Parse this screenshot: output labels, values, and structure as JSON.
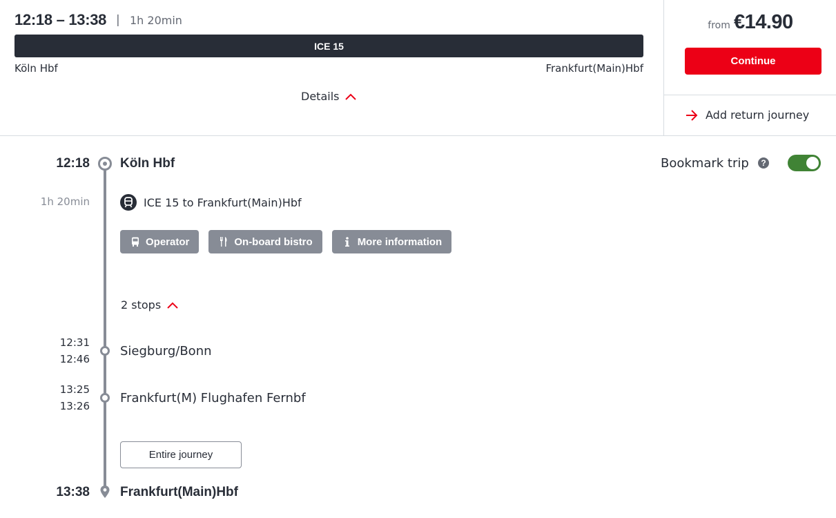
{
  "summary": {
    "time_range": "12:18 – 13:38",
    "separator": "|",
    "duration": "1h 20min",
    "train": "ICE 15",
    "from_station": "Köln Hbf",
    "to_station": "Frankfurt(Main)Hbf",
    "details_label": "Details"
  },
  "side": {
    "from_label": "from",
    "price": "€14.90",
    "continue_label": "Continue",
    "return_label": "Add return journey"
  },
  "journey": {
    "departure": {
      "time": "12:18",
      "station": "Köln Hbf"
    },
    "duration": "1h 20min",
    "train_line": "ICE 15 to Frankfurt(Main)Hbf",
    "chips": {
      "operator": "Operator",
      "bistro": "On-board bistro",
      "info": "More information"
    },
    "stops_label": "2 stops",
    "stops": [
      {
        "arr": "12:31",
        "dep": "12:46",
        "station": "Siegburg/Bonn"
      },
      {
        "arr": "13:25",
        "dep": "13:26",
        "station": "Frankfurt(M) Flughafen Fernbf"
      }
    ],
    "entire_journey_label": "Entire journey",
    "arrival": {
      "time": "13:38",
      "station": "Frankfurt(Main)Hbf"
    }
  },
  "bookmark": {
    "label": "Bookmark trip",
    "help": "?",
    "enabled": true
  },
  "colors": {
    "accent_red": "#ec0016",
    "dark": "#282d37",
    "grey": "#878c96",
    "toggle_on": "#408335"
  }
}
